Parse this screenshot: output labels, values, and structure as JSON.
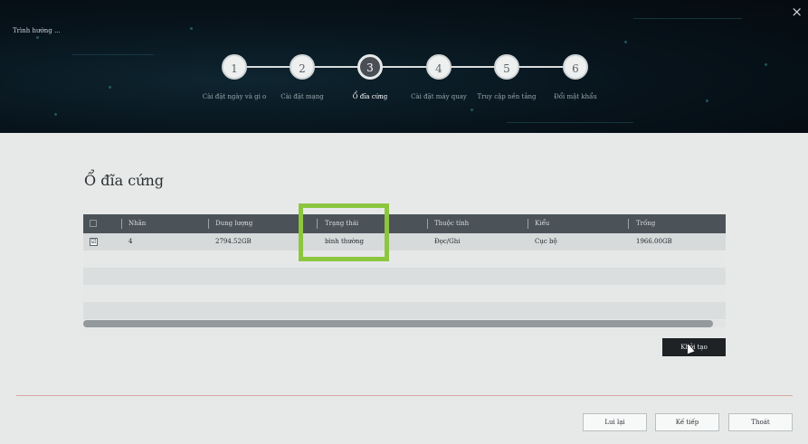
{
  "window": {
    "title": "Trình hướng ...",
    "close_glyph": "×"
  },
  "steps": [
    {
      "number": "1",
      "label": "Cài đặt ngày và gi o"
    },
    {
      "number": "2",
      "label": "Cài đặt mạng"
    },
    {
      "number": "3",
      "label": "Ổ đĩa cứng",
      "active": true
    },
    {
      "number": "4",
      "label": "Cài đặt máy quay"
    },
    {
      "number": "5",
      "label": "Truy cập nền tảng"
    },
    {
      "number": "6",
      "label": "Đổi mật khẩu"
    }
  ],
  "page_title": "Ổ đĩa cứng",
  "table": {
    "headers": [
      "Nhãn",
      "Dung lượng",
      "Trạng thái",
      "Thuộc tính",
      "Kiểu",
      "Trống"
    ],
    "rows": [
      {
        "checked": true,
        "check_glyph": "☑",
        "cells": [
          "4",
          "2794.52GB",
          "bình thường",
          "Đọc/Ghi",
          "Cục bộ",
          "1966.00GB"
        ]
      }
    ]
  },
  "buttons": {
    "init": "Khởi tạo",
    "back": "Lui lại",
    "next": "Kế tiếp",
    "exit": "Thoát"
  },
  "colors": {
    "highlight": "#8cc63f",
    "header_bg": "#07121a",
    "table_header": "#4c5358"
  },
  "icons": {
    "close": "close-icon",
    "checkbox": "checkbox-icon",
    "cursor": "mouse-cursor-icon"
  }
}
